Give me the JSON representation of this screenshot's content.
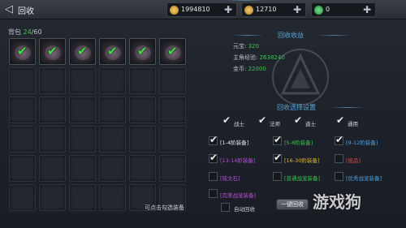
{
  "header": {
    "title": "回收"
  },
  "currencies": [
    {
      "name": "gold",
      "value": "1994810",
      "color": "#e2a93a"
    },
    {
      "name": "ingot",
      "value": "12710",
      "color": "#e2a93a"
    },
    {
      "name": "gem",
      "value": "0",
      "color": "#3fbf5a"
    }
  ],
  "bag": {
    "label": "背包",
    "count": "24",
    "capacity": "/60"
  },
  "income": {
    "title": "回收收益",
    "rows": [
      {
        "label": "元宝:",
        "value": "320"
      },
      {
        "label": "主角经验:",
        "value": "2638240"
      },
      {
        "label": "金币:",
        "value": "22000"
      }
    ]
  },
  "settings": {
    "title": "回收选择设置",
    "classes": [
      {
        "label": "战士",
        "checked": true
      },
      {
        "label": "法师",
        "checked": true
      },
      {
        "label": "道士",
        "checked": true
      },
      {
        "label": "通用",
        "checked": true
      }
    ],
    "options": [
      {
        "label": "[1-4阶装备]",
        "checked": true,
        "color": "#e8eaed"
      },
      {
        "label": "[5-8阶装备]",
        "checked": true,
        "color": "#39c64b"
      },
      {
        "label": "[9-12阶装备]",
        "checked": true,
        "color": "#4ea0e6"
      },
      {
        "label": "[13-14阶装备]",
        "checked": true,
        "color": "#b650d9"
      },
      {
        "label": "[16-30阶装备]",
        "checked": true,
        "color": "#e0b43a"
      },
      {
        "label": "[极品]",
        "checked": false,
        "color": "#e04a4a"
      },
      {
        "label": "[铭文石]",
        "checked": false,
        "color": "#b650d9"
      },
      {
        "label": "[普通战宠装备]",
        "checked": false,
        "color": "#39c64b"
      },
      {
        "label": "[优秀战宠装备]",
        "checked": false,
        "color": "#4ea0e6"
      },
      {
        "label": "[完美战宠装备]",
        "checked": false,
        "color": "#b650d9"
      }
    ],
    "auto_label": "自动回收",
    "auto_checked": false,
    "hint": "可点击勾选装备",
    "button_label": "一键回收"
  },
  "watermark": "游戏狗"
}
